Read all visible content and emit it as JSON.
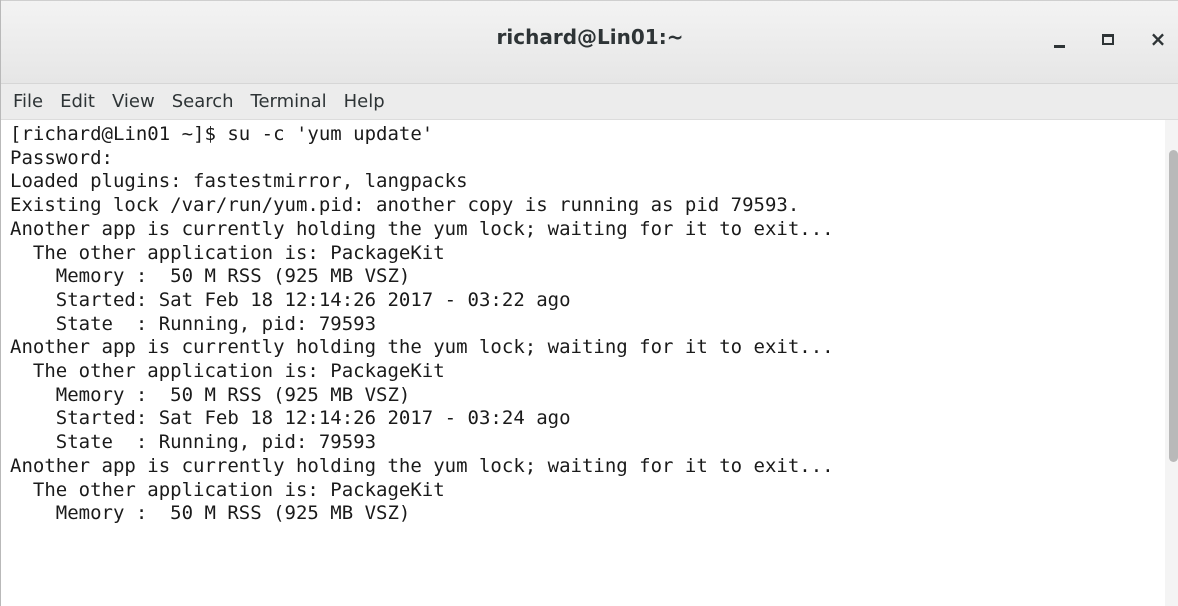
{
  "window": {
    "title": "richard@Lin01:~",
    "controls": {
      "minimize": "minimize",
      "maximize": "maximize",
      "close": "×"
    }
  },
  "menu": {
    "items": [
      "File",
      "Edit",
      "View",
      "Search",
      "Terminal",
      "Help"
    ]
  },
  "terminal": {
    "lines": [
      "[richard@Lin01 ~]$ su -c 'yum update'",
      "Password:",
      "Loaded plugins: fastestmirror, langpacks",
      "Existing lock /var/run/yum.pid: another copy is running as pid 79593.",
      "Another app is currently holding the yum lock; waiting for it to exit...",
      "  The other application is: PackageKit",
      "    Memory :  50 M RSS (925 MB VSZ)",
      "    Started: Sat Feb 18 12:14:26 2017 - 03:22 ago",
      "    State  : Running, pid: 79593",
      "Another app is currently holding the yum lock; waiting for it to exit...",
      "  The other application is: PackageKit",
      "    Memory :  50 M RSS (925 MB VSZ)",
      "    Started: Sat Feb 18 12:14:26 2017 - 03:24 ago",
      "    State  : Running, pid: 79593",
      "Another app is currently holding the yum lock; waiting for it to exit...",
      "  The other application is: PackageKit",
      "    Memory :  50 M RSS (925 MB VSZ)"
    ]
  }
}
